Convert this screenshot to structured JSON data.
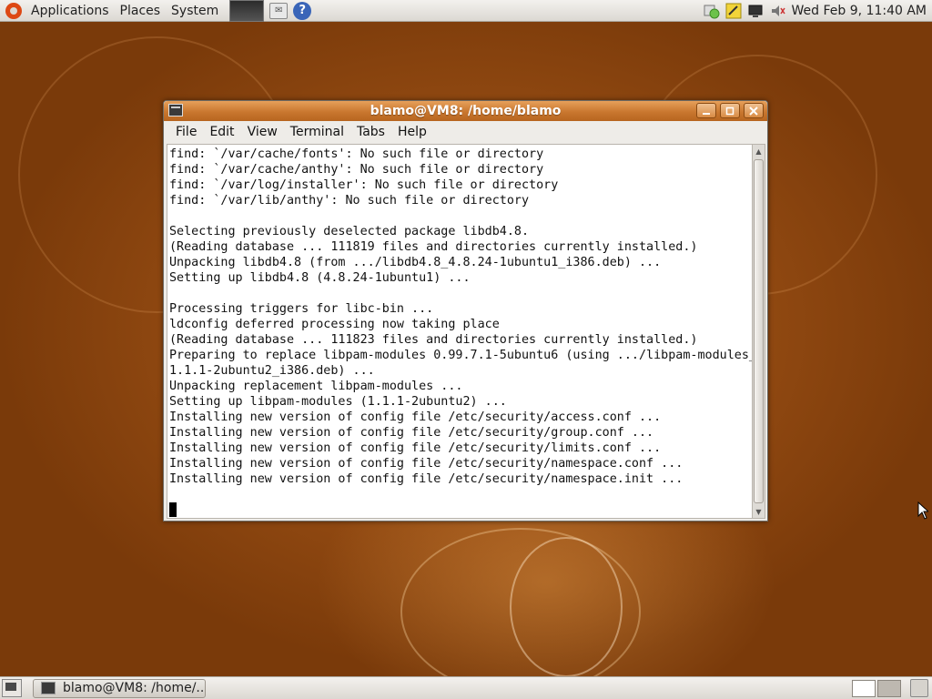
{
  "top_panel": {
    "menus": [
      "Applications",
      "Places",
      "System"
    ],
    "clock": "Wed Feb  9, 11:40 AM"
  },
  "window": {
    "title": "blamo@VM8: /home/blamo",
    "menu": [
      "File",
      "Edit",
      "View",
      "Terminal",
      "Tabs",
      "Help"
    ],
    "terminal_lines": [
      "find: `/var/cache/fonts': No such file or directory",
      "find: `/var/cache/anthy': No such file or directory",
      "find: `/var/log/installer': No such file or directory",
      "find: `/var/lib/anthy': No such file or directory",
      "",
      "Selecting previously deselected package libdb4.8.",
      "(Reading database ... 111819 files and directories currently installed.)",
      "Unpacking libdb4.8 (from .../libdb4.8_4.8.24-1ubuntu1_i386.deb) ...",
      "Setting up libdb4.8 (4.8.24-1ubuntu1) ...",
      "",
      "Processing triggers for libc-bin ...",
      "ldconfig deferred processing now taking place",
      "(Reading database ... 111823 files and directories currently installed.)",
      "Preparing to replace libpam-modules 0.99.7.1-5ubuntu6 (using .../libpam-modules_",
      "1.1.1-2ubuntu2_i386.deb) ...",
      "Unpacking replacement libpam-modules ...",
      "Setting up libpam-modules (1.1.1-2ubuntu2) ...",
      "Installing new version of config file /etc/security/access.conf ...",
      "Installing new version of config file /etc/security/group.conf ...",
      "Installing new version of config file /etc/security/limits.conf ...",
      "Installing new version of config file /etc/security/namespace.conf ...",
      "Installing new version of config file /etc/security/namespace.init ...",
      "",
      ""
    ]
  },
  "bottom_panel": {
    "task_label": "blamo@VM8: /home/..."
  },
  "colors": {
    "titlebar": "#c9772f",
    "desktop": "#9a4f14"
  }
}
